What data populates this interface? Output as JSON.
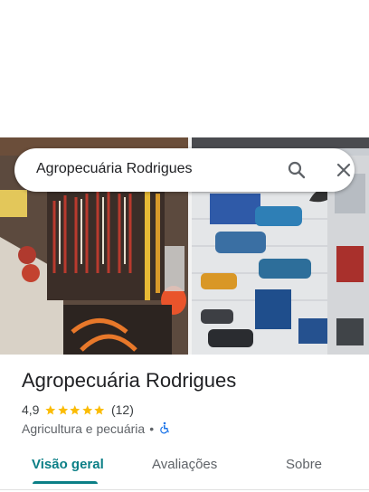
{
  "search": {
    "query": "Agropecuária Rodrigues"
  },
  "place": {
    "name": "Agropecuária Rodrigues",
    "rating": "4,9",
    "stars": 5,
    "review_count": "(12)",
    "category": "Agricultura e pecuária",
    "separator": "•",
    "accessibility_icon": "wheelchair-icon"
  },
  "photo": {
    "description_icon": "store-photo"
  },
  "tabs": [
    {
      "label": "Visão geral",
      "active": true
    },
    {
      "label": "Avaliações",
      "active": false
    },
    {
      "label": "Sobre",
      "active": false
    }
  ],
  "colors": {
    "accent": "#0b7f86",
    "star": "#fbbc04",
    "accessibility": "#1a73e8"
  }
}
